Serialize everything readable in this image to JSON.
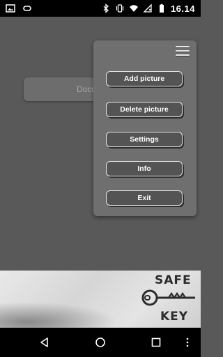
{
  "status_bar": {
    "time": "16.14",
    "left_icons": [
      "image-icon",
      "voicemail-icon"
    ],
    "right_icons": [
      "bluetooth-icon",
      "vibrate-icon",
      "wifi-icon",
      "no-sim-icon",
      "battery-icon"
    ]
  },
  "document_card": {
    "label": "Docu"
  },
  "menu": {
    "icon": "hamburger-menu-icon",
    "items": [
      {
        "label": "Add picture"
      },
      {
        "label": "Delete picture"
      },
      {
        "label": "Settings"
      },
      {
        "label": "Info"
      },
      {
        "label": "Exit"
      }
    ]
  },
  "banner": {
    "logo_word_top": "SAFE",
    "logo_word_bottom": "KEY",
    "logo_icon": "key-icon"
  },
  "nav_bar": {
    "items": [
      "back-icon",
      "home-icon",
      "recents-icon",
      "overflow-icon"
    ]
  },
  "colors": {
    "background": "#595959",
    "menu": "#6f6f6f",
    "button": "#545454",
    "button_border": "#e6e6e6"
  }
}
